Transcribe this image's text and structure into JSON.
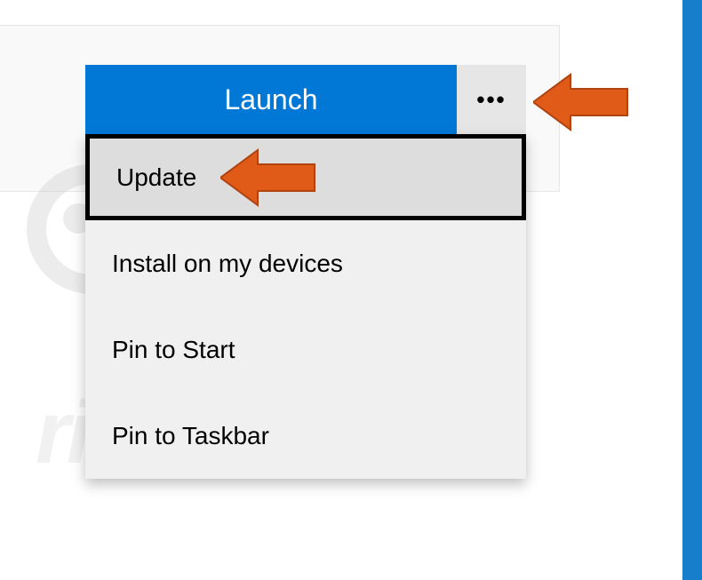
{
  "launch_button": {
    "label": "Launch"
  },
  "more_button": {
    "glyph": "•••"
  },
  "menu": {
    "items": [
      {
        "label": "Update"
      },
      {
        "label": "Install on my devices"
      },
      {
        "label": "Pin to Start"
      },
      {
        "label": "Pin to Taskbar"
      }
    ]
  },
  "colors": {
    "accent": "#0178d6",
    "side_bar": "#167ecb",
    "arrow": "#e05a18"
  }
}
